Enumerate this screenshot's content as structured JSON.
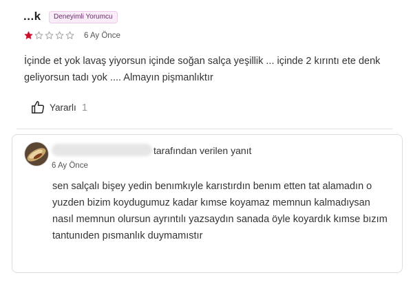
{
  "review": {
    "reviewer_name": "...k",
    "badge": "Deneyimli Yorumcu",
    "rating": 1,
    "max_rating": 5,
    "date": "6 Ay Önce",
    "comment": "İçinde et yok lavaş yiyorsun içinde soğan salça yeşillik ... içinde 2 kırıntı ete denk geliyorsun tadı yok .... Almayın pişmanlıktır",
    "helpful_label": "Yararlı",
    "helpful_count": "1"
  },
  "reply": {
    "by_label": "tarafından verilen yanıt",
    "date": "6 Ay Önce",
    "text": "sen salçalı bişey yedin benımkıyle karıstırdın benım etten tat alamadın o yuzden bizim koydugumuz kadar kımse koyamaz memnun kalmadıysan nasıl memnun olursun ayrıntılı yazsaydın sanada öyle koyardık kımse bızım tantunıden pısmanlık duymamıstır"
  },
  "colors": {
    "star_filled": "#c8102e",
    "star_empty": "#9a9a9a",
    "badge_text": "#6b2a6b",
    "badge_bg": "#f9eef8"
  },
  "icons": {
    "stars": "star-icon",
    "helpful": "thumbs-up-icon",
    "avatar": "seller-avatar"
  }
}
